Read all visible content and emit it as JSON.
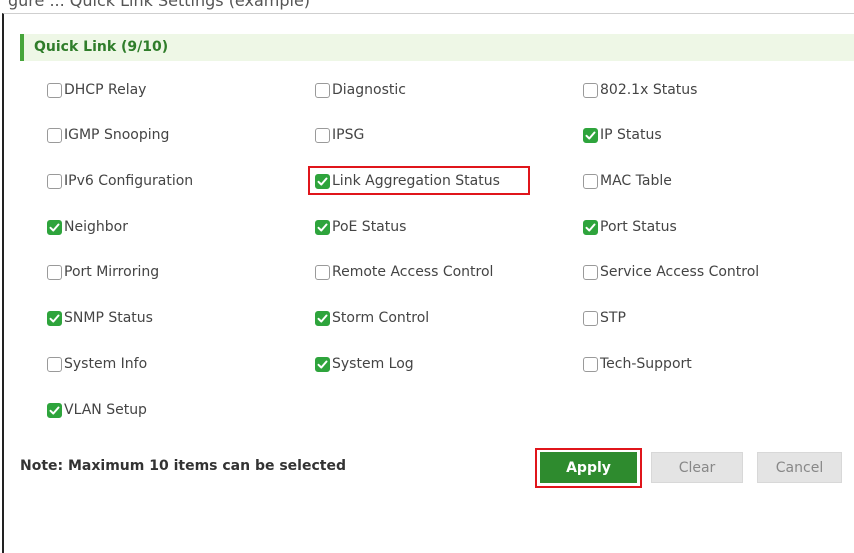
{
  "header": {
    "caption": "gure ... Quick Link Settings (example)"
  },
  "section": {
    "title": "Quick Link (9/10)"
  },
  "items": [
    {
      "label": "DHCP Relay",
      "checked": false
    },
    {
      "label": "Diagnostic",
      "checked": false
    },
    {
      "label": "802.1x Status",
      "checked": false
    },
    {
      "label": "IGMP Snooping",
      "checked": false
    },
    {
      "label": "IPSG",
      "checked": false
    },
    {
      "label": "IP Status",
      "checked": true
    },
    {
      "label": "IPv6 Configuration",
      "checked": false
    },
    {
      "label": "Link Aggregation Status",
      "checked": true
    },
    {
      "label": "MAC Table",
      "checked": false
    },
    {
      "label": "Neighbor",
      "checked": true
    },
    {
      "label": "PoE Status",
      "checked": true
    },
    {
      "label": "Port Status",
      "checked": true
    },
    {
      "label": "Port Mirroring",
      "checked": false
    },
    {
      "label": "Remote Access Control",
      "checked": false
    },
    {
      "label": "Service Access Control",
      "checked": false
    },
    {
      "label": "SNMP Status",
      "checked": true
    },
    {
      "label": "Storm Control",
      "checked": true
    },
    {
      "label": "STP",
      "checked": false
    },
    {
      "label": "System Info",
      "checked": false
    },
    {
      "label": "System Log",
      "checked": true
    },
    {
      "label": "Tech-Support",
      "checked": false
    },
    {
      "label": "VLAN Setup",
      "checked": true
    }
  ],
  "footer": {
    "note": "Note: Maximum 10 items can be selected",
    "apply_label": "Apply",
    "clear_label": "Clear",
    "cancel_label": "Cancel"
  },
  "colors": {
    "accent_green": "#2ea43c",
    "header_bg": "#eef7e6",
    "highlight_red": "#e0151b"
  }
}
